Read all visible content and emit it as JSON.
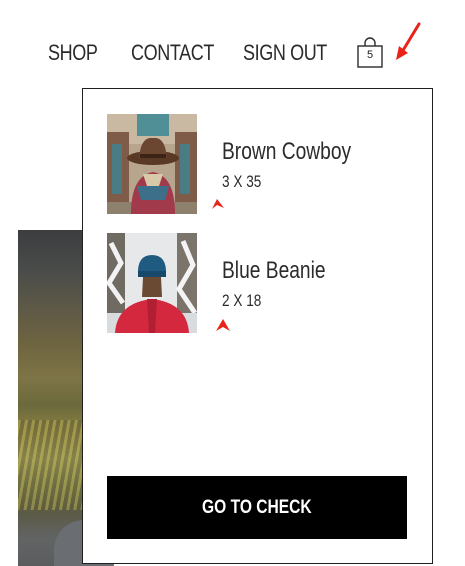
{
  "nav": {
    "items": [
      {
        "label": "SHOP"
      },
      {
        "label": "CONTACT"
      },
      {
        "label": "SIGN OUT"
      }
    ],
    "cart": {
      "icon": "shopping-bag-icon",
      "count": "5"
    }
  },
  "cart_dropdown": {
    "items": [
      {
        "name": "Brown Cowboy",
        "qty": "3 X 35",
        "image": "woman-brown-cowboy-hat-photo"
      },
      {
        "name": "Blue Beanie",
        "qty": "2 X 18",
        "image": "woman-blue-beanie-snow-photo"
      }
    ],
    "checkout_label": "GO TO CHECK"
  },
  "annotation_color": "#e8231a"
}
